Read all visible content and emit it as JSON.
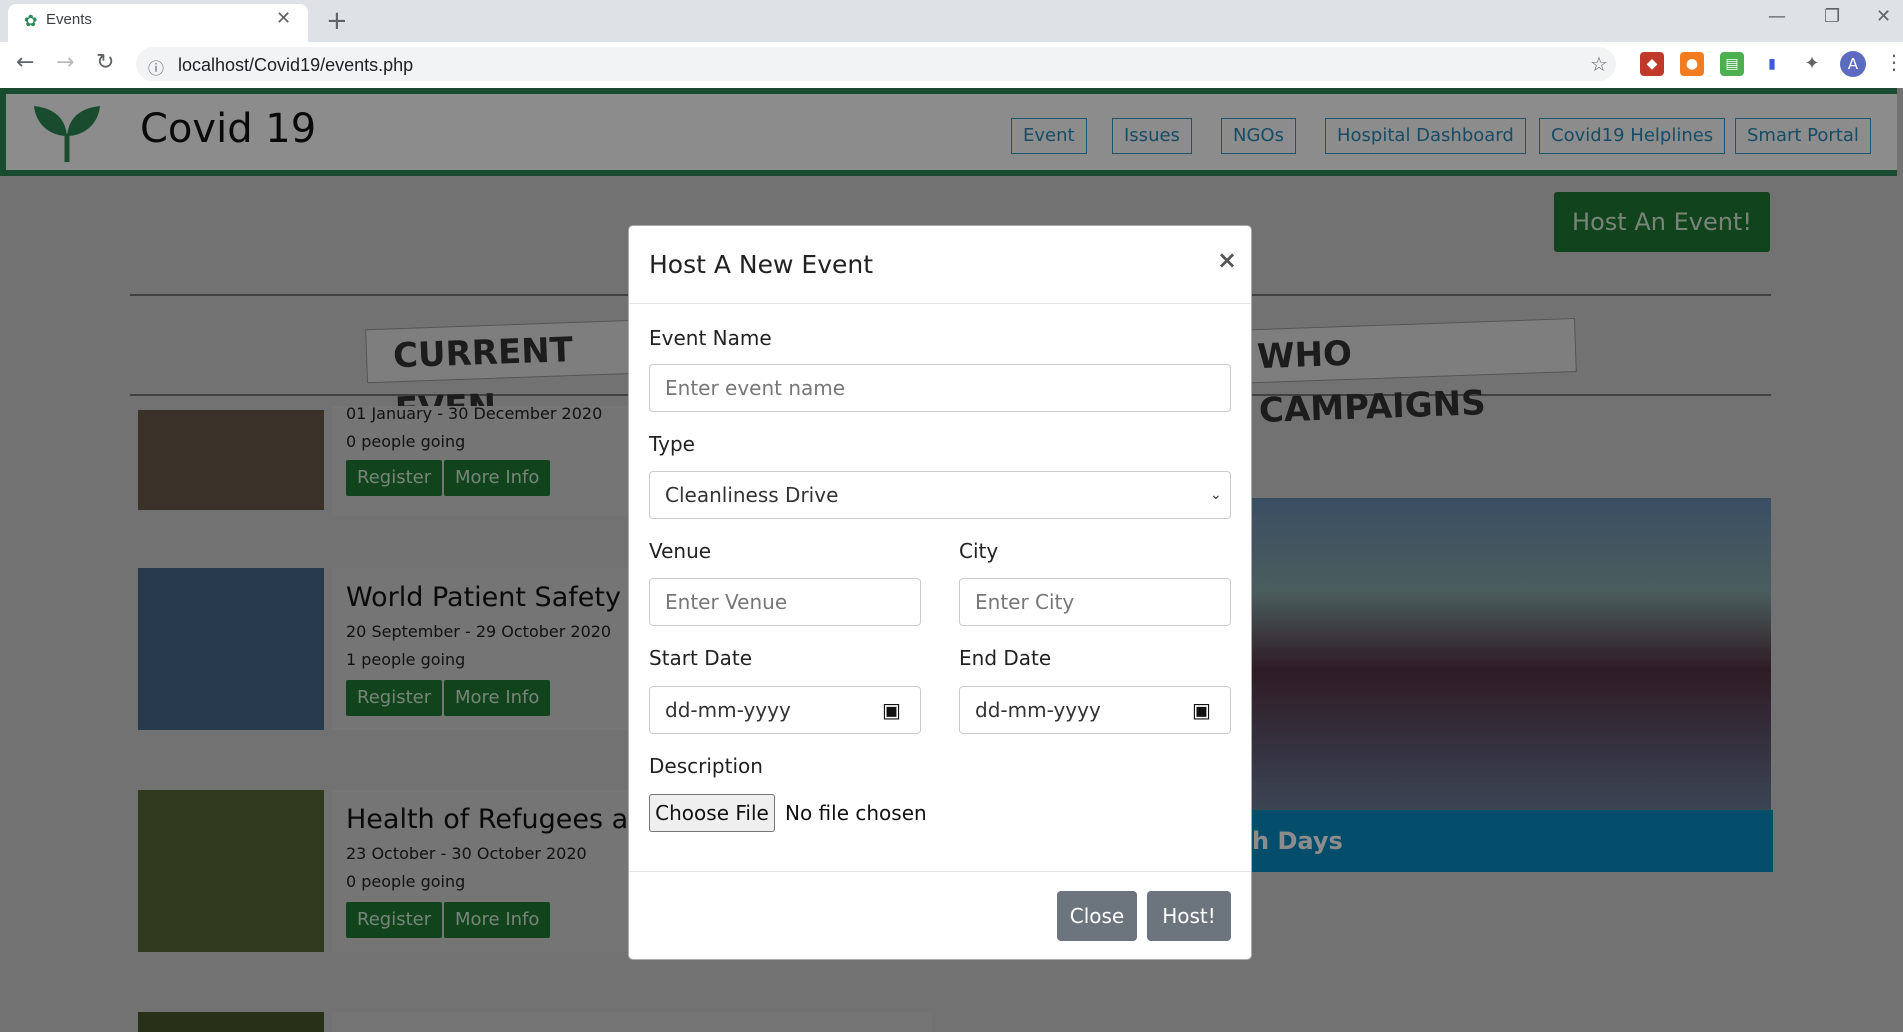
{
  "browser": {
    "tab_title": "Events",
    "url": "localhost/Covid19/events.php"
  },
  "site": {
    "brand": "Covid 19",
    "nav": [
      "Event",
      "Issues",
      "NGOs",
      "Hospital Dashboard",
      "Covid19 Helplines",
      "Smart Portal"
    ],
    "host_button": "Host An Event!",
    "section_current": "CURRENT EVEN",
    "section_who": "WHO CAMPAIGNS",
    "events": [
      {
        "title": "",
        "date": "01 January - 30 December 2020",
        "going": "0 people going"
      },
      {
        "title": "World Patient Safety D",
        "date": "20 September - 29 October 2020",
        "going": "1 people going"
      },
      {
        "title": "Health of Refugees and",
        "date": "23 October - 30 October 2020",
        "going": "0 people going"
      }
    ],
    "register_label": "Register",
    "more_info_label": "More Info",
    "campaign_caption": "h Days"
  },
  "modal": {
    "title": "Host A New Event",
    "close_x": "×",
    "event_name_label": "Event Name",
    "event_name_placeholder": "Enter event name",
    "type_label": "Type",
    "type_selected": "Cleanliness Drive",
    "venue_label": "Venue",
    "venue_placeholder": "Enter Venue",
    "city_label": "City",
    "city_placeholder": "Enter City",
    "start_date_label": "Start Date",
    "end_date_label": "End Date",
    "date_placeholder": "dd-mm-yyyy",
    "description_label": "Description",
    "choose_file": "Choose File",
    "no_file": "No file chosen",
    "close_button": "Close",
    "host_button": "Host!"
  },
  "colors": {
    "brand_green": "#1f7a35",
    "nav_border": "#3a9ac9",
    "modal_button": "#6c757d"
  }
}
